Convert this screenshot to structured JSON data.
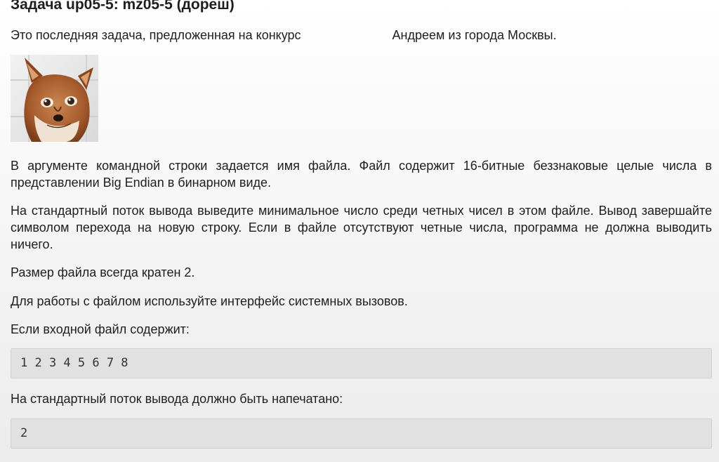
{
  "problem": {
    "title": "Задача up05-5: mz05-5 (дореш)",
    "intro_before": "Это последняя задача, предложенная на конкурс",
    "intro_after": "Андреем из города Москвы.",
    "paragraph1": "В аргументе командной строки задается имя файла. Файл содержит 16-битные беззнаковые целые числа в представлении Big Endian в бинарном виде.",
    "paragraph2": "На стандартный поток вывода выведите минимальное число среди четных чисел в этом файле. Вывод завершайте символом перехода на новую строку. Если в файле отсутствуют четные числа, программа не должна выводить ничего.",
    "paragraph3": "Размер файла всегда кратен 2.",
    "paragraph4": "Для работы с файлом используйте интерфейс системных вызовов.",
    "input_label": "Если входной файл содержит:",
    "input_example": "1 2 3 4 5 6 7 8",
    "output_label": "На стандартный поток вывода должно быть напечатано:",
    "output_example": "2"
  },
  "image": {
    "icon": "fox-photo",
    "colors": {
      "fur": "#b5683a",
      "background": "#e6e6e6"
    }
  }
}
